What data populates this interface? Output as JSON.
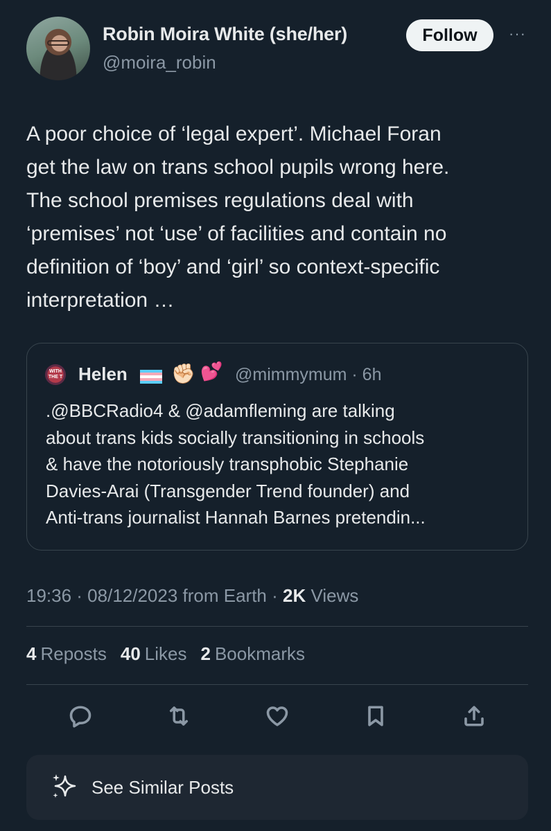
{
  "post": {
    "author_name": "Robin Moira White (she/her)",
    "author_handle": "@moira_robin",
    "follow_label": "Follow",
    "more_label": "···",
    "text": "A poor choice of ‘legal expert’.  Michael Foran\nget the law on trans school pupils wrong here.\nThe school premises regulations deal with\n‘premises’ not ‘use’ of facilities and contain no\ndefinition of ‘boy’ and ‘girl’ so context-specific\ninterpretation …"
  },
  "quoted": {
    "avatar_text": "WITH THE T",
    "name": "Helen",
    "emoji_fist": "✊🏻",
    "emoji_hearts": "💕",
    "handle_time": "@mimmymum · 6h",
    "text": ".@BBCRadio4 & @adamfleming are talking\nabout trans kids socially transitioning in schools\n& have the notoriously transphobic Stephanie\nDavies-Arai (Transgender Trend founder) and\nAnti-trans journalist Hannah Barnes pretendin..."
  },
  "meta": {
    "time_date": "19:36 · 08/12/2023 from Earth · ",
    "views_count": "2K",
    "views_label": " Views"
  },
  "stats": {
    "reposts_count": "4",
    "reposts_label": "Reposts",
    "likes_count": "40",
    "likes_label": "Likes",
    "bookmarks_count": "2",
    "bookmarks_label": "Bookmarks"
  },
  "actions": [
    "reply-icon",
    "repost-icon",
    "like-icon",
    "bookmark-icon",
    "share-icon"
  ],
  "similar": {
    "label": "See Similar Posts"
  },
  "colors": {
    "background": "#15202b",
    "text": "#e7e9ea",
    "secondary": "#8b98a5",
    "border": "#38444d",
    "flag": [
      "#5bcefa",
      "#f5a9b8",
      "#ffffff",
      "#f5a9b8",
      "#5bcefa"
    ]
  }
}
